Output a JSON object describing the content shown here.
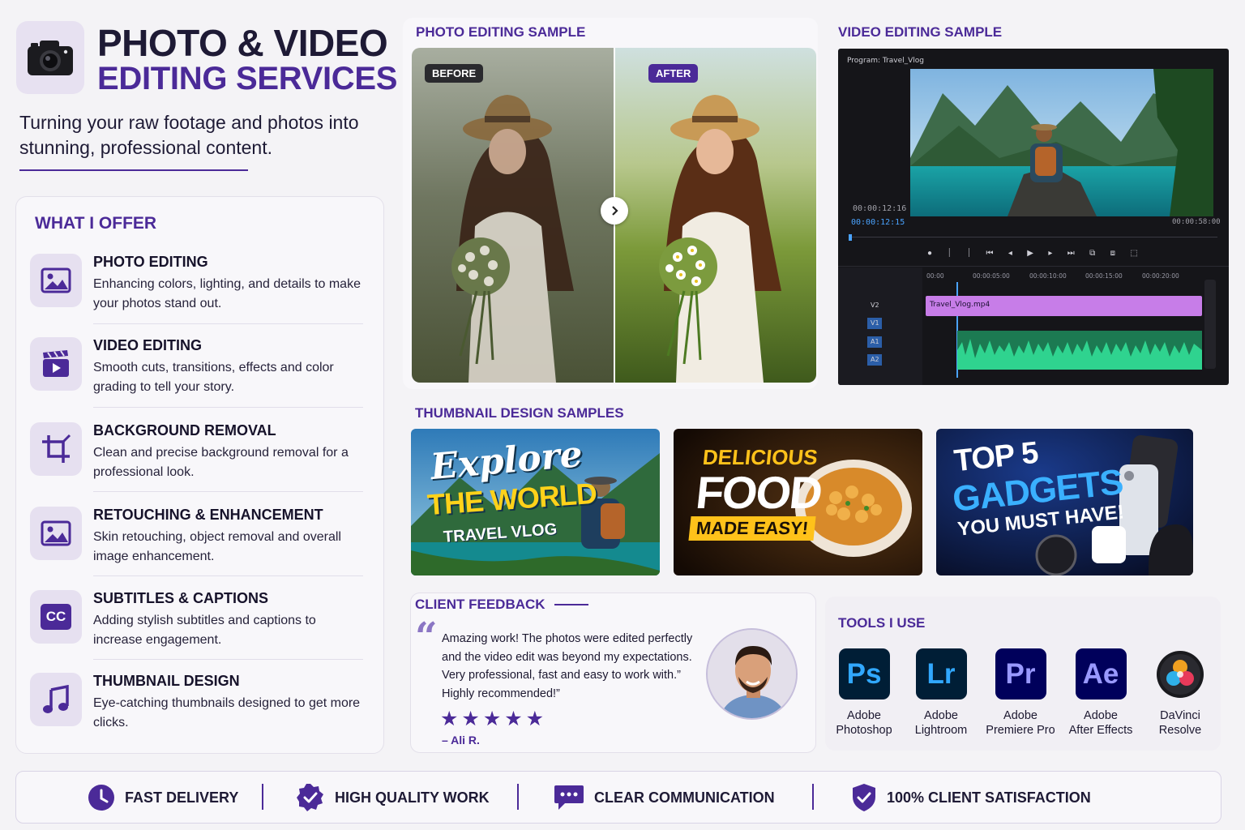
{
  "header": {
    "title_line1": "PHOTO & VIDEO",
    "title_line2": "EDITING SERVICES",
    "tagline": "Turning your raw footage and photos into stunning, professional content."
  },
  "offer": {
    "heading": "WHAT I OFFER",
    "items": [
      {
        "icon": "image-icon",
        "title": "PHOTO EDITING",
        "desc": "Enhancing colors, lighting, and details to make your photos stand out."
      },
      {
        "icon": "clapperboard-icon",
        "title": "VIDEO EDITING",
        "desc": "Smooth cuts, transitions, effects and color grading to tell your story."
      },
      {
        "icon": "crop-icon",
        "title": "BACKGROUND REMOVAL",
        "desc": "Clean and precise background removal for a professional look."
      },
      {
        "icon": "image-icon",
        "title": "RETOUCHING & ENHANCEMENT",
        "desc": "Skin retouching, object removal and overall image enhancement."
      },
      {
        "icon": "cc-icon",
        "title": "SUBTITLES & CAPTIONS",
        "desc": "Adding stylish subtitles and captions to increase engagement."
      },
      {
        "icon": "music-note-icon",
        "title": "THUMBNAIL DESIGN",
        "desc": "Eye-catching thumbnails designed to get more clicks."
      }
    ]
  },
  "photo_sample": {
    "title": "PHOTO EDITING SAMPLE",
    "before_label": "BEFORE",
    "after_label": "AFTER"
  },
  "video_sample": {
    "title": "VIDEO EDITING SAMPLE",
    "program_label": "Program: Travel_Vlog",
    "timecode_small": "00:00:12:16",
    "timecode_current": "00:00:12:15",
    "timecode_end": "00:00:58:00",
    "ruler": [
      "00:00",
      "00:00:05:00",
      "00:00:10:00",
      "00:00:15:00",
      "00:00:20:00"
    ],
    "clip_name": "Travel_Vlog.mp4",
    "tracks": [
      "V2",
      "V1",
      "A1",
      "A2"
    ]
  },
  "thumbnails": {
    "title": "THUMBNAIL DESIGN SAMPLES",
    "t1": {
      "line1": "Explore",
      "line2": "THE WORLD",
      "line3": "TRAVEL VLOG"
    },
    "t2": {
      "line1": "DELICIOUS",
      "line2": "FOOD",
      "line3": "MADE EASY!"
    },
    "t3": {
      "line1": "TOP 5",
      "line2": "GADGETS",
      "line3": "YOU MUST HAVE!"
    }
  },
  "feedback": {
    "title": "CLIENT FEEDBACK",
    "quote_mark": "“",
    "quote": "Amazing work! The photos were edited perfectly and the video edit was beyond my expectations. Very professional, fast and easy to work with.” Highly recommended!”",
    "stars": "★★★★★",
    "rating": 5,
    "author": "– Ali R."
  },
  "tools": {
    "title": "TOOLS I USE",
    "items": [
      {
        "abbr": "Ps",
        "name1": "Adobe",
        "name2": "Photoshop",
        "bg": "#001e36",
        "fg": "#31a8ff"
      },
      {
        "abbr": "Lr",
        "name1": "Adobe",
        "name2": "Lightroom",
        "bg": "#001e36",
        "fg": "#31a8ff"
      },
      {
        "abbr": "Pr",
        "name1": "Adobe",
        "name2": "Premiere Pro",
        "bg": "#00005b",
        "fg": "#9999ff"
      },
      {
        "abbr": "Ae",
        "name1": "Adobe",
        "name2": "After Effects",
        "bg": "#00005b",
        "fg": "#9999ff"
      },
      {
        "abbr": "",
        "name1": "DaVinci",
        "name2": "Resolve",
        "bg": "#ffffff",
        "fg": "#000000"
      }
    ]
  },
  "footer": {
    "items": [
      {
        "icon": "clock-icon",
        "label": "FAST DELIVERY"
      },
      {
        "icon": "badge-check-icon",
        "label": "HIGH QUALITY WORK"
      },
      {
        "icon": "chat-bubble-icon",
        "label": "CLEAR COMMUNICATION"
      },
      {
        "icon": "shield-check-icon",
        "label": "100% CLIENT SATISFACTION"
      }
    ]
  },
  "colors": {
    "accent": "#4b2a98",
    "clip": "#c77de8",
    "audio": "#2fb67c"
  }
}
